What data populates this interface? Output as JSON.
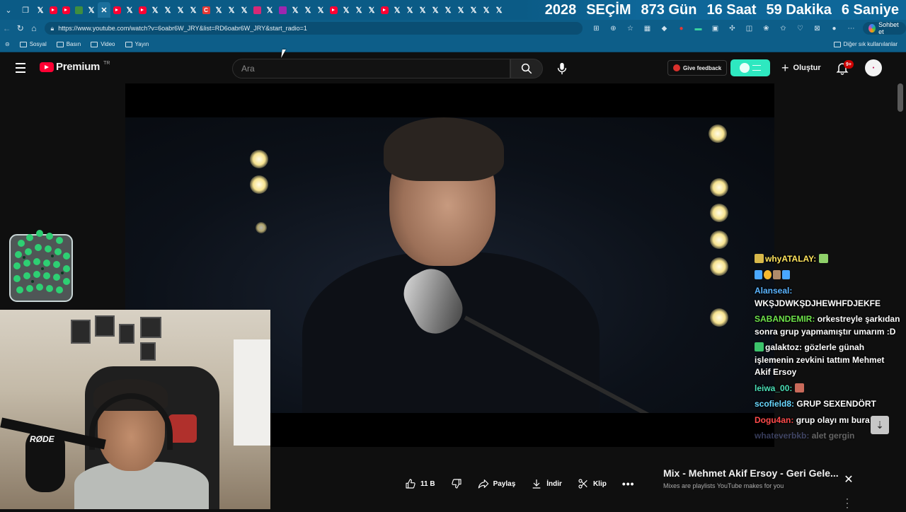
{
  "browser": {
    "countdown": {
      "year": "2028",
      "event": "SEÇİM",
      "days": "873 Gün",
      "hours": "16 Saat",
      "minutes": "59 Dakika",
      "seconds": "6 Saniye"
    },
    "url": "https://www.youtube.com/watch?v=6oabr6W_JRY&list=RD6oabr6W_JRY&start_radio=1",
    "chat_button": "Sohbet et",
    "bookmarks": [
      "Sosyal",
      "Basın",
      "Video",
      "Yayın"
    ],
    "bookmarks_right": "Diğer sık kullanılanlar"
  },
  "youtube": {
    "logo_text": "Premium",
    "region": "TR",
    "search_placeholder": "Ara",
    "feedback_label": "Give feedback",
    "create_label": "Oluştur",
    "notification_count": "9+"
  },
  "chat": [
    {
      "user": "whyATALAY:",
      "msg": "",
      "color": "#ffe45c"
    },
    {
      "user": "",
      "msg": "",
      "color": "#ffffff"
    },
    {
      "user": "Alanseal:",
      "msg": "WKŞJDWKŞDJHEWHFDJEKFE",
      "color": "#5ab4ff"
    },
    {
      "user": "SABANDEMIR:",
      "msg": "orkestreyle şarkıdan sonra grup yapmamıştır umarım :D",
      "color": "#6ee34a"
    },
    {
      "user": "galaktoz:",
      "msg": "gözlerle günah işlemenin zevkini tattım Mehmet Akif Ersoy",
      "color": "#ffffff"
    },
    {
      "user": "leiwa_00:",
      "msg": "",
      "color": "#4adfb6"
    },
    {
      "user": "scofield8:",
      "msg": "GRUP SEXENDÖRT",
      "color": "#6ad8ff"
    },
    {
      "user": "Dogu4an:",
      "msg": "grup olayı mı bura",
      "color": "#ff4a4a"
    },
    {
      "user": "whateverbkb:",
      "msg": "alet gergin",
      "color": "#9aa8ff"
    }
  ],
  "actions": {
    "likes": "11 B",
    "share": "Paylaş",
    "download": "İndir",
    "clip": "Klip"
  },
  "mix": {
    "title": "Mix - Mehmet Akif Ersoy - Geri Gele...",
    "subtitle": "Mixes are playlists YouTube makes for you"
  },
  "webcam": {
    "mic_brand": "RØDE"
  }
}
